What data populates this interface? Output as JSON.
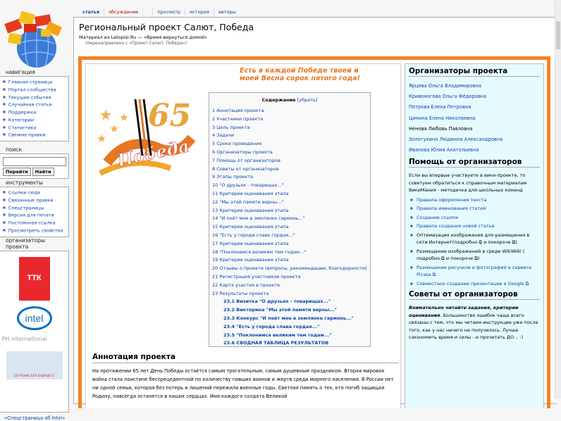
{
  "tabs": [
    "статья",
    "обсуждение",
    "",
    "просмотр",
    "история",
    "авторы"
  ],
  "title": "Региональный проект Салют, Победа",
  "subtitle": "Материал из Letopisi.Ru — «Время вернуться домой»",
  "redirect": "(перенаправлено с «Проект Салют, Победа»)",
  "nav": {
    "title": "навигация",
    "items": [
      "Главная страница",
      "Портал сообщества",
      "Текущие события",
      "Случайная статья",
      "Поддержка",
      "Категории",
      "Статистика",
      "Свежие правки"
    ]
  },
  "search": {
    "title": "поиск",
    "go": "Перейти",
    "find": "Найти"
  },
  "tools": {
    "title": "инструменты",
    "items": [
      "Ссылки сюда",
      "Связанные правки",
      "Спецстраницы",
      "Версия для печати",
      "Постоянная ссылка",
      "Просмотреть свойства"
    ]
  },
  "orgs": {
    "title": "организаторы проекта",
    "ttk": "ТТК",
    "intel": "intel",
    "ph": "PH international",
    "future": "ОБУЧЕНИЕ ДЛЯ БУДУЩЕГО",
    "link": "«Спецстраница об Intel»"
  },
  "slogan": "Есть в каждой Победе твоей и моей Весна сорок пятого года!",
  "emblem": {
    "number": "65",
    "word": "Победа"
  },
  "toc": {
    "title": "Содержание",
    "toggle": "[убрать]",
    "items": [
      {
        "t": "1 Аннотация проекта"
      },
      {
        "t": "2 Участники проекта"
      },
      {
        "t": "3 Цель проекта"
      },
      {
        "t": "4 Задачи"
      },
      {
        "t": "5 Сроки проведения"
      },
      {
        "t": "6 Организаторы проекта"
      },
      {
        "t": "7 Помощь от организаторов"
      },
      {
        "t": "8 Советы от организаторов"
      },
      {
        "t": "9 Этапы проекта"
      },
      {
        "t": "10 \"О друзьях - товарищах...\""
      },
      {
        "t": "11 Критерии оценивания этапа"
      },
      {
        "t": "12 \"Мы этой памяти верны...\""
      },
      {
        "t": "13 Критерии оценивания этапа"
      },
      {
        "t": "14 \"И поёт мне в землянке гармонь...\""
      },
      {
        "t": "15 Критерии оценивания этапа"
      },
      {
        "t": "16 \"Есть у города слава гордая...\""
      },
      {
        "t": "17 Критерии оценивания этапа"
      },
      {
        "t": "18 \"Поклонимся великим тем годам...\""
      },
      {
        "t": "19 Критерии оценивания этапа"
      },
      {
        "t": "20 Отзывы о проекте (вопросы, рекомендации, благодарности)"
      },
      {
        "t": "21 Регистрация участников проекта"
      },
      {
        "t": "22 Карта участия в проекте"
      },
      {
        "t": "23 Результаты проекта"
      },
      {
        "t": "23.1 Визитка \"О друзьях - товарищах...\"",
        "sub": true,
        "b": true
      },
      {
        "t": "23.2 Викторина \"Мы этой памяти верны...\"",
        "sub": true,
        "b": true
      },
      {
        "t": "23.3 Конкурс \"И поёт мне в землянке гармонь...\"",
        "sub": true,
        "b": true
      },
      {
        "t": "23.4 \"Есть у города слава гордая...\"",
        "sub": true,
        "b": true
      },
      {
        "t": "23.5 \"Поклонимся великим тем годам...\"",
        "sub": true,
        "b": true
      },
      {
        "t": "23.6 СВОДНАЯ ТАБЛИЦА РЕЗУЛЬТАТОВ",
        "sub": true,
        "b": true
      }
    ]
  },
  "annotation": {
    "heading": "Аннотация проекта",
    "text": "На протяжении 65 лет День Победы остаётся самым трогательным, самым душевным праздником. Вторая мировая война стала поистине беспрецедентной по количеству павших воинов и жертв среди мирного населения. В России нет ни одной семьи, которая без потерь и лишений пережила военные годы. Светлая память о тех, кто погиб защищая Родину, навсегда останется в наших сердцах. Имя каждого солдата Великой"
  },
  "right": {
    "org_heading": "Организаторы проекта",
    "org_names": [
      "Ярцева Ольга Владимировна",
      "Кривоногова Ольга Фёдоровна",
      "Петрова Елена Петровна",
      "Цинина Елена Николаевна",
      "Ненова Любовь Павловна",
      "Золотухина Людмила Александровна",
      "Иванова Юлия Анатольевна"
    ],
    "help_heading": "Помощь от организаторов",
    "help_text": "Если вы впервые участвуете в вики-проекте, то советуем обратиться к справочным материалам ВикиМания - методичка для школьных команд",
    "help_items": [
      "Правила оформления текста",
      "Правила именования статей",
      "Создание ссылок",
      "Правила создания новой статьи",
      "Оптимизация изображения для размещения в сети Интернет(подробно ⧉ и покороче ⧉)",
      "Размещение изображений в среде WikiWiki ( подробно ⧉ и покороче ⧉)",
      "Размещение рисунков и фотографий в сервисе Picasa ⧉",
      "Совместное создание презентации в Google ⧉"
    ],
    "advice_heading": "Советы от организаторов",
    "advice_bold": "Внимательно читайте задания, критерии оценивания",
    "advice_text": ". Большинство ошибок чаще всего связаны с тем, что мы читаем инструкции уже после того, как у нас ничего не получилось. Лучше сэкономить время и силы - и прочитать ДО... :)"
  }
}
